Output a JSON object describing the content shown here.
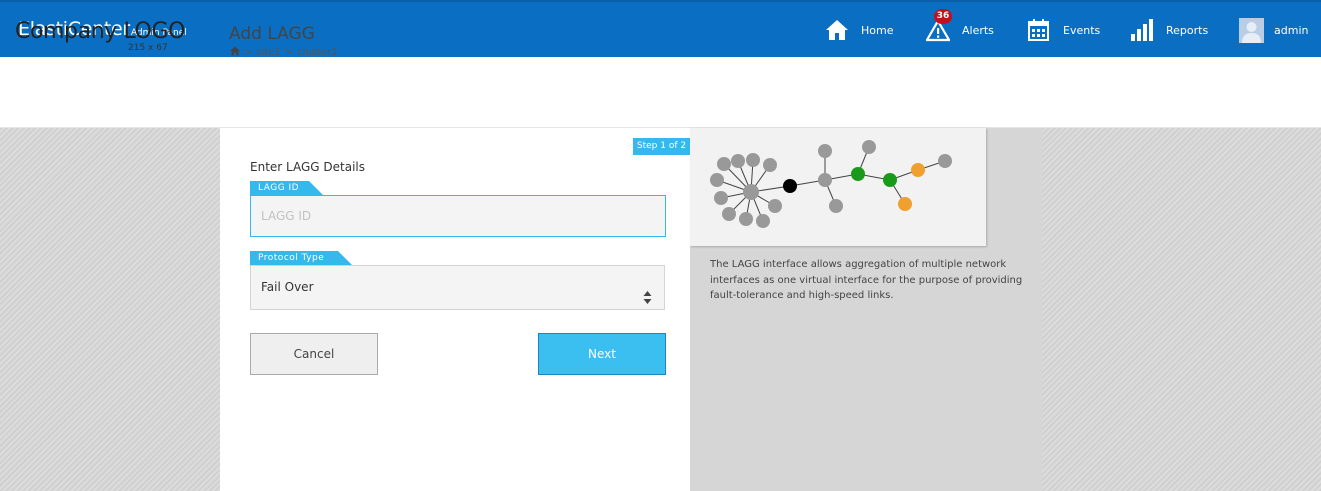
{
  "navbar": {
    "brand_main": "ElastiCenter",
    "brand_sub": "Admin Panel",
    "items": [
      {
        "label": "Home",
        "icon": "home-icon"
      },
      {
        "label": "Alerts",
        "icon": "alert-icon",
        "badge": "36"
      },
      {
        "label": "Events",
        "icon": "calendar-icon"
      },
      {
        "label": "Reports",
        "icon": "bar-chart-icon"
      },
      {
        "label": "admin",
        "icon": "avatar"
      }
    ],
    "colors": {
      "bar": "#0a6fc2",
      "badge": "#c40f1d"
    }
  },
  "header": {
    "logo_text": "Company LOGO",
    "logo_size": "215 x 67",
    "page_title": "Add LAGG",
    "breadcrumb": [
      "site1",
      "cluster1"
    ],
    "breadcrumb_sep": ">"
  },
  "form": {
    "step": "Step 1 of 2",
    "section_title": "Enter LAGG Details",
    "lagg_id_label": "LAGG ID",
    "lagg_id_placeholder": "LAGG ID",
    "lagg_id_value": "",
    "protocol_label": "Protocol Type",
    "protocol_value": "Fail Over",
    "cancel_label": "Cancel",
    "next_label": "Next",
    "accent": "#35b8ec"
  },
  "info": {
    "description": "The LAGG interface allows aggregation of multiple network interfaces as one virtual interface for the purpose of providing fault-tolerance and high-speed links.",
    "node_colors": {
      "grey": "#999999",
      "black": "#000000",
      "green": "#1a9a1a",
      "orange": "#f0a030"
    }
  }
}
